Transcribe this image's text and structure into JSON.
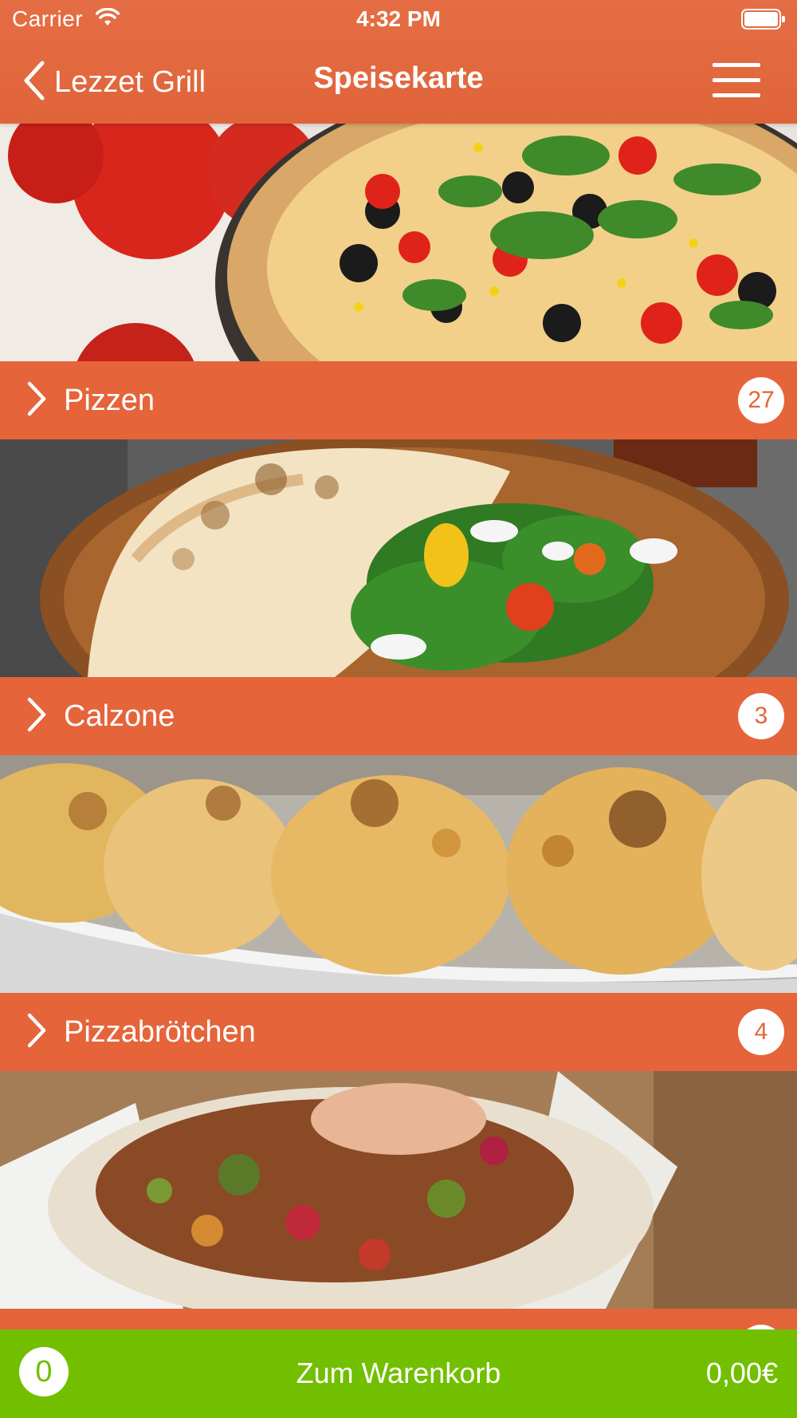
{
  "status_bar": {
    "carrier": "Carrier",
    "time": "4:32 PM"
  },
  "nav": {
    "back_label": "Lezzet Grill",
    "title": "Speisekarte"
  },
  "categories": [
    {
      "label": "Pizzen",
      "count": "27",
      "image": "pizza-photo"
    },
    {
      "label": "Calzone",
      "count": "3",
      "image": "calzone-photo"
    },
    {
      "label": "Pizzabrötchen",
      "count": "4",
      "image": "pizza-rolls-photo"
    },
    {
      "label": "",
      "count": "",
      "image": "kebab-photo"
    }
  ],
  "cart": {
    "count": "0",
    "label": "Zum Warenkorb",
    "total": "0,00€"
  },
  "colors": {
    "header": "#e5643a",
    "category_bar": "#e5643a",
    "cart_bar": "#72bf00"
  }
}
